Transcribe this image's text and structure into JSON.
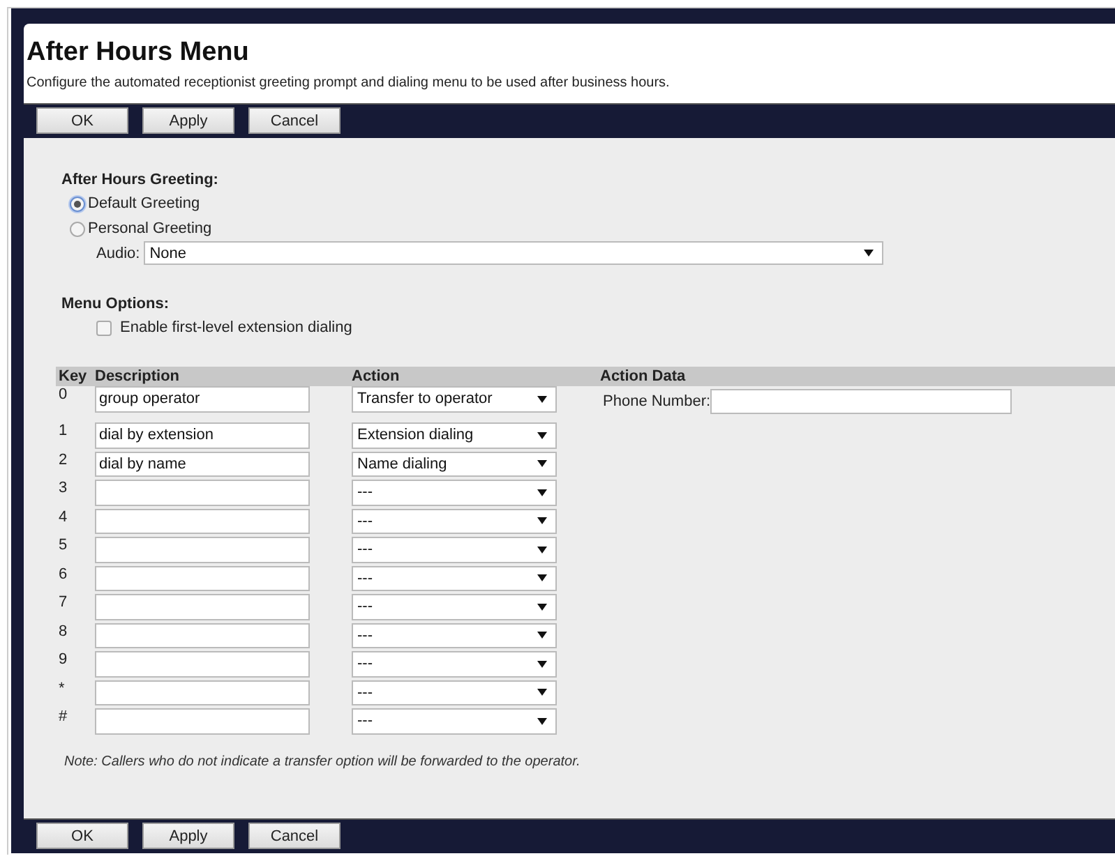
{
  "page": {
    "title": "After Hours Menu",
    "description": "Configure the automated receptionist greeting prompt and dialing menu to be used after business hours."
  },
  "top_toolbar": {
    "buttons": [
      "OK",
      "Apply",
      "Cancel"
    ]
  },
  "greeting": {
    "heading": "After Hours Greeting:",
    "options": [
      {
        "label": "Default Greeting",
        "selected": true
      },
      {
        "label": "Personal Greeting",
        "selected": false
      }
    ],
    "audio": {
      "label": "Audio:",
      "value": "None"
    }
  },
  "menu_options": {
    "heading": "Menu Options:",
    "checkbox": {
      "label": "Enable first-level extension dialing",
      "checked": false
    }
  },
  "table": {
    "columns": [
      "Key",
      "Description",
      "Action",
      "Action Data"
    ],
    "rows": [
      {
        "key": "0",
        "description": "group operator",
        "action": "Transfer to operator",
        "action_data": {
          "label": "Phone Number:"
        }
      },
      {
        "key": "1",
        "description": "dial by extension",
        "action": "Extension dialing"
      },
      {
        "key": "2",
        "description": "dial by name",
        "action": "Name dialing"
      },
      {
        "key": "3",
        "action": "---"
      },
      {
        "key": "4",
        "action": "---"
      },
      {
        "key": "5",
        "action": "---"
      },
      {
        "key": "6",
        "action": "---"
      },
      {
        "key": "7",
        "action": "---"
      },
      {
        "key": "8",
        "action": "---"
      },
      {
        "key": "9",
        "action": "---"
      },
      {
        "key": "*",
        "action": "---"
      },
      {
        "key": "#",
        "action": "---"
      }
    ]
  },
  "note": "Note: Callers who do not indicate a transfer option will be forwarded to the operator.",
  "bottom_toolbar": {
    "buttons": [
      "OK",
      "Apply",
      "Cancel"
    ]
  }
}
